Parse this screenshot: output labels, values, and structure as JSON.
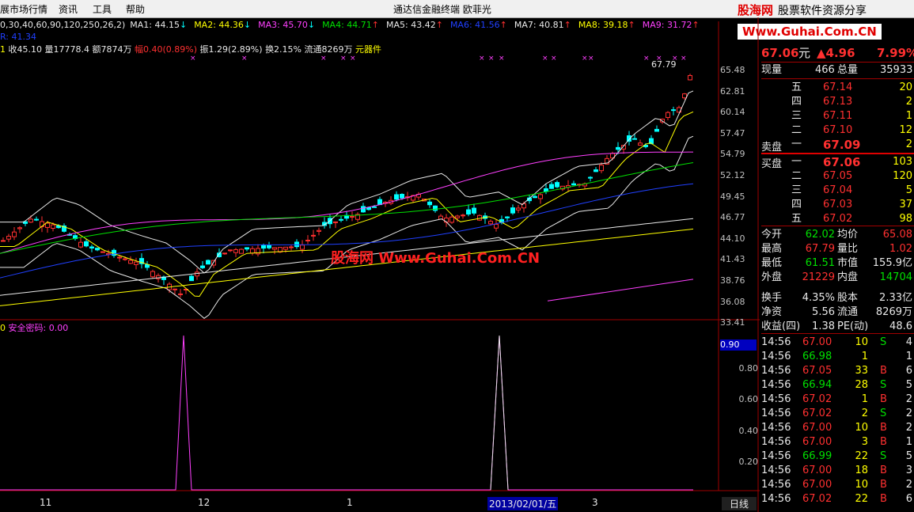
{
  "menu": [
    "展市场行情",
    "资讯",
    "工具",
    "帮助"
  ],
  "app_title": "通达信金融终端  欧菲光",
  "logo": {
    "brand": "股海网",
    "slogan": "股票软件资源分享",
    "url": "Www.Guhai.Com.CN"
  },
  "watermark": "股海网 Www.Guhai.Com.CN",
  "ma_line": {
    "params": "0,30,40,60,90,120,250,26,2)",
    "items": [
      {
        "label": "MA1: 44.15",
        "arrow": "↓",
        "color": "#e8e8e8"
      },
      {
        "label": "MA2: 44.36",
        "arrow": "↓",
        "color": "#ffff00"
      },
      {
        "label": "MA3: 45.70",
        "arrow": "↓",
        "color": "#ff40ff"
      },
      {
        "label": "MA4: 44.71",
        "arrow": "↑",
        "color": "#00e000"
      },
      {
        "label": "MA5: 43.42",
        "arrow": "↑",
        "color": "#e8e8e8"
      },
      {
        "label": "MA6: 41.56",
        "arrow": "↑",
        "color": "#2040ff"
      },
      {
        "label": "MA7: 40.81",
        "arrow": "↑",
        "color": "#e8e8e8"
      },
      {
        "label": "MA8: 39.18",
        "arrow": "↑",
        "color": "#ffff00"
      },
      {
        "label": "MA9: 31.72",
        "arrow": "↑",
        "color": "#ff40ff"
      }
    ],
    "extra": "R: 41.34"
  },
  "info_line": {
    "close": "收45.10",
    "vol": "量17778.4",
    "amount": "额7874万",
    "change": "幅0.40(0.89%)",
    "amp": "振1.29(2.89%)",
    "turnover": "换2.15%",
    "float": "流通8269万",
    "sector": "元器件"
  },
  "y_ticks": [
    "65.48",
    "62.81",
    "60.14",
    "57.47",
    "54.79",
    "52.12",
    "49.45",
    "46.77",
    "44.10",
    "41.43",
    "38.76",
    "36.08",
    "33.41"
  ],
  "peak_label": "67.79",
  "indicator": {
    "title": "安全密码: 0.00",
    "prefix": "0",
    "value_box": "0.90",
    "ticks": [
      "0.80",
      "0.60",
      "0.40",
      "0.20"
    ]
  },
  "x_ticks": [
    "11",
    "12",
    "1",
    "2013/02/01/五",
    "3"
  ],
  "period": "日线",
  "quote": {
    "price": "67.06",
    "unit": "元",
    "chg": "▲4.96",
    "pct": "7.99%"
  },
  "volume_row": {
    "now_label": "现量",
    "now": "466",
    "total_label": "总量",
    "total": "35933"
  },
  "asks": [
    {
      "lv": "五",
      "price": "67.14",
      "vol": "20"
    },
    {
      "lv": "四",
      "price": "67.13",
      "vol": "2"
    },
    {
      "lv": "三",
      "price": "67.11",
      "vol": "1"
    },
    {
      "lv": "二",
      "price": "67.10",
      "vol": "12"
    },
    {
      "lv": "一",
      "price": "67.09",
      "vol": "2"
    }
  ],
  "bids": [
    {
      "lv": "一",
      "price": "67.06",
      "vol": "103"
    },
    {
      "lv": "二",
      "price": "67.05",
      "vol": "120"
    },
    {
      "lv": "三",
      "price": "67.04",
      "vol": "5"
    },
    {
      "lv": "四",
      "price": "67.03",
      "vol": "37"
    },
    {
      "lv": "五",
      "price": "67.02",
      "vol": "98"
    }
  ],
  "ask_title": "卖盘",
  "bid_title": "买盘",
  "stats": [
    [
      {
        "k": "今开",
        "v": "62.02",
        "c": "grn"
      },
      {
        "k": "均价",
        "v": "65.08",
        "c": "red"
      }
    ],
    [
      {
        "k": "最高",
        "v": "67.79",
        "c": "red"
      },
      {
        "k": "量比",
        "v": "1.02",
        "c": "red"
      }
    ],
    [
      {
        "k": "最低",
        "v": "61.51",
        "c": "grn"
      },
      {
        "k": "市值",
        "v": "155.9亿",
        "c": "wht"
      }
    ],
    [
      {
        "k": "外盘",
        "v": "21229",
        "c": "red"
      },
      {
        "k": "内盘",
        "v": "14704",
        "c": "grn"
      }
    ],
    [
      {
        "k": "换手",
        "v": "4.35%",
        "c": "wht"
      },
      {
        "k": "股本",
        "v": "2.33亿",
        "c": "wht"
      }
    ],
    [
      {
        "k": "净资",
        "v": "5.56",
        "c": "wht"
      },
      {
        "k": "流通",
        "v": "8269万",
        "c": "wht"
      }
    ],
    [
      {
        "k": "收益(四)",
        "v": "1.38",
        "c": "wht"
      },
      {
        "k": "PE(动)",
        "v": "48.6",
        "c": "wht"
      }
    ]
  ],
  "ticks": [
    {
      "t": "14:56",
      "p": "67.00",
      "v": "10",
      "s": "S",
      "n": "4"
    },
    {
      "t": "14:56",
      "p": "66.98",
      "v": "1",
      "s": "",
      "n": "1"
    },
    {
      "t": "14:56",
      "p": "67.05",
      "v": "33",
      "s": "B",
      "n": "6"
    },
    {
      "t": "14:56",
      "p": "66.94",
      "v": "28",
      "s": "S",
      "n": "5"
    },
    {
      "t": "14:56",
      "p": "67.02",
      "v": "1",
      "s": "B",
      "n": "2"
    },
    {
      "t": "14:56",
      "p": "67.02",
      "v": "2",
      "s": "S",
      "n": "2"
    },
    {
      "t": "14:56",
      "p": "67.00",
      "v": "10",
      "s": "B",
      "n": "2"
    },
    {
      "t": "14:56",
      "p": "67.00",
      "v": "3",
      "s": "B",
      "n": "1"
    },
    {
      "t": "14:56",
      "p": "66.99",
      "v": "22",
      "s": "S",
      "n": "5"
    },
    {
      "t": "14:56",
      "p": "67.00",
      "v": "18",
      "s": "B",
      "n": "3"
    },
    {
      "t": "14:56",
      "p": "67.00",
      "v": "10",
      "s": "B",
      "n": "2"
    },
    {
      "t": "14:56",
      "p": "67.02",
      "v": "22",
      "s": "B",
      "n": "6"
    }
  ],
  "colors": {
    "up": "#ff3030",
    "down": "#00ffff",
    "grid": "#a00000",
    "bg": "#000000"
  }
}
